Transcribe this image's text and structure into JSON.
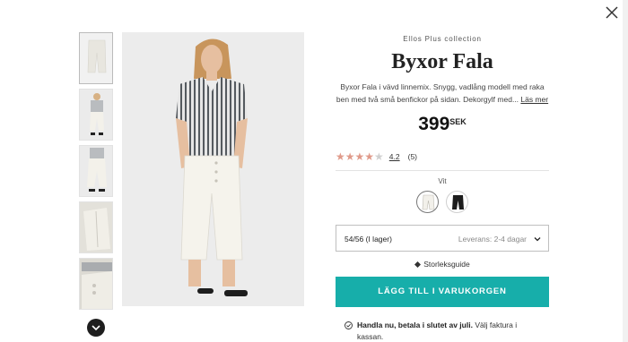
{
  "close": {
    "icon": "close-icon"
  },
  "thumbnails": [
    {
      "alt": "front-product-thumb",
      "icon": "pants-front-icon"
    },
    {
      "alt": "back-model-thumb",
      "icon": "model-back-icon"
    },
    {
      "alt": "side-model-thumb",
      "icon": "model-side-icon"
    },
    {
      "alt": "detail-thumb",
      "icon": "detail-icon"
    },
    {
      "alt": "pocket-thumb",
      "icon": "pocket-icon"
    }
  ],
  "product": {
    "collection": "Ellos Plus collection",
    "title": "Byxor Fala",
    "description": "Byxor Fala i vävd linnemix. Snygg, vadlång modell med raka ben med två små benfickor på sidan. Dekorgylf med...",
    "read_more": "Läs mer",
    "price": "399",
    "currency": "SEK",
    "rating": {
      "value_text": "4.2",
      "value": 4.2,
      "max": 5,
      "count_text": "(5)"
    },
    "color_label": "Vit",
    "colors": [
      {
        "name": "white",
        "hex": "#f2f0ea",
        "selected": true
      },
      {
        "name": "black",
        "hex": "#1c1c1c",
        "selected": false
      }
    ],
    "size": {
      "value": "54/56 (I lager)",
      "delivery": "Leverans: 2-4 dagar"
    },
    "size_guide": "Storleksguide",
    "cta": "LÄGG TILL I VARUKORGEN",
    "promo_bold": "Handla nu, betala i slutet av juli.",
    "promo_rest": "Välj faktura i kassan."
  },
  "colors": {
    "accent": "#17aeaa",
    "star": "#e09a8a"
  }
}
